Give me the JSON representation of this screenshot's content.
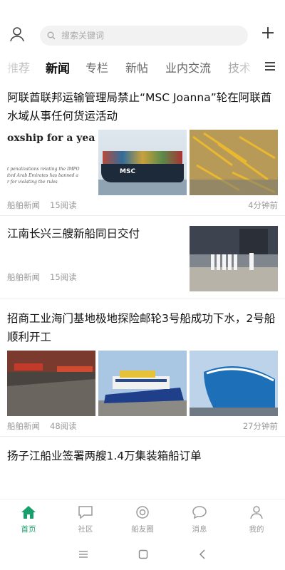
{
  "search": {
    "placeholder": "搜索关键词"
  },
  "tabs": [
    {
      "label": "推荐"
    },
    {
      "label": "新闻"
    },
    {
      "label": "专栏"
    },
    {
      "label": "新帖"
    },
    {
      "label": "业内交流"
    },
    {
      "label": "技术"
    }
  ],
  "active_tab": "新闻",
  "articles": [
    {
      "title": "阿联酋联邦运输管理局禁止“MSC Joanna”轮在阿联酋水域从事任何货运活动",
      "image_text_1": "oxship for a year o",
      "image_text_2": "t penalizations relating the IMPO",
      "image_text_3": "ited Arab Emirates has banned a",
      "image_text_4": "r for violating the rules",
      "ship_brand": "MSC",
      "source": "船舶新闻",
      "views": "15阅读",
      "time": "4分钟前"
    },
    {
      "title": "江南长兴三艘新船同日交付",
      "source": "船舶新闻",
      "views": "15阅读",
      "time": ""
    },
    {
      "title": "招商工业海门基地极地探险邮轮3号船成功下水，2号船顺利开工",
      "source": "船舶新闻",
      "views": "48阅读",
      "time": "27分钟前"
    },
    {
      "title": "扬子江船业签署两艘1.4万集装箱船订单"
    }
  ],
  "bottom_nav": [
    {
      "label": "首页",
      "icon": "home-icon"
    },
    {
      "label": "社区",
      "icon": "chat-square-icon"
    },
    {
      "label": "船友圈",
      "icon": "compass-icon"
    },
    {
      "label": "消息",
      "icon": "message-icon"
    },
    {
      "label": "我的",
      "icon": "person-icon"
    }
  ],
  "colors": {
    "accent": "#1aa06d",
    "muted": "#999999"
  }
}
